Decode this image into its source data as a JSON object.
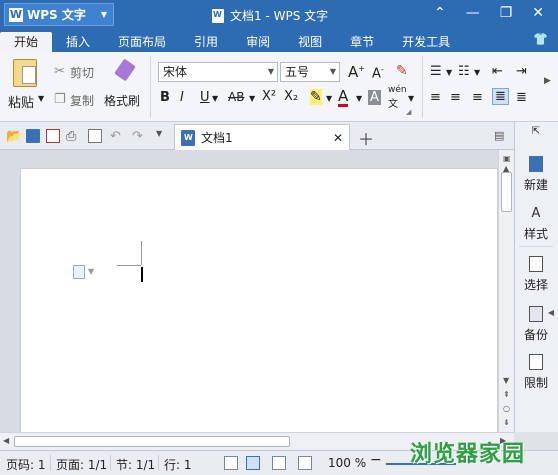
{
  "titlebar": {
    "app_name": "WPS 文字",
    "doc_title": "文档1 - WPS 文字"
  },
  "menu": {
    "tabs": [
      "开始",
      "插入",
      "页面布局",
      "引用",
      "审阅",
      "视图",
      "章节",
      "开发工具"
    ],
    "active": "开始"
  },
  "ribbon": {
    "paste": "粘贴",
    "cut": "剪切",
    "copy": "复制",
    "format_painter": "格式刷",
    "font_name": "宋体",
    "font_size": "五号",
    "bold": "B",
    "italic": "I",
    "underline": "U",
    "strike": "AB",
    "superscript": "X²",
    "subscript": "X₂",
    "font_color": "A",
    "char_shade": "A",
    "phonetic": "wén",
    "grow_font": "A",
    "shrink_font": "A"
  },
  "tabs": {
    "doc_tab": "文档1"
  },
  "sidepanel": {
    "items": [
      "新建",
      "样式",
      "选择",
      "备份",
      "限制"
    ]
  },
  "status": {
    "page_num": "页码: 1",
    "pages": "页面: 1/1",
    "section": "节: 1/1",
    "line": "行: 1",
    "zoom": "100 %"
  },
  "watermark": "浏览器家园",
  "colors": {
    "title_bg": "#2d6bb3",
    "accent": "#3d6fb5",
    "watermark": "#2ea043"
  }
}
